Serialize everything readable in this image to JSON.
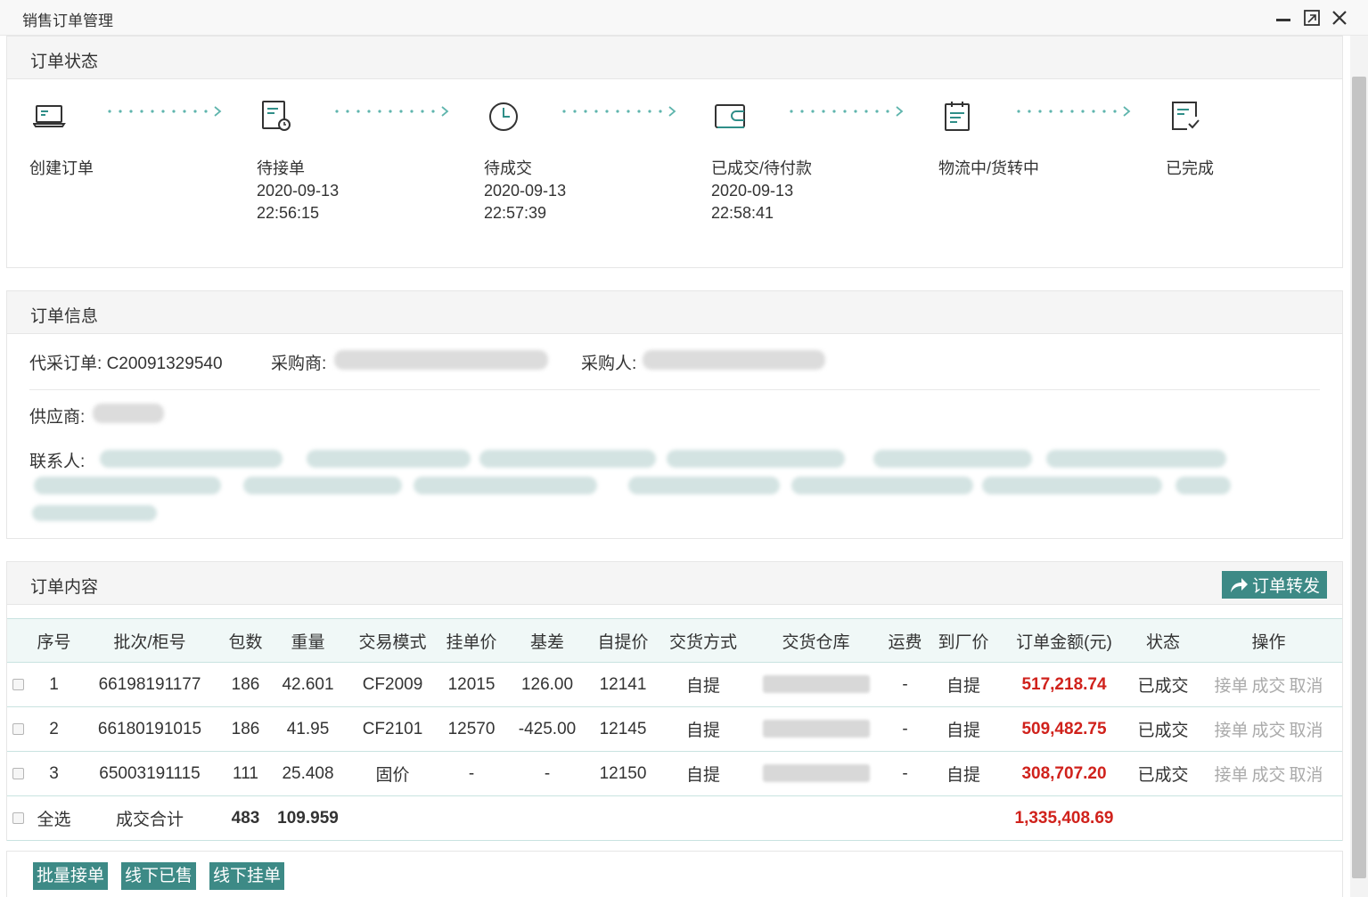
{
  "window": {
    "title": "销售订单管理"
  },
  "status_panel": {
    "title": "订单状态",
    "steps": [
      {
        "label": "创建订单",
        "icon": "laptop-icon",
        "date": "",
        "time": ""
      },
      {
        "label": "待接单",
        "icon": "document-clock-icon",
        "date": "2020-09-13",
        "time": "22:56:15"
      },
      {
        "label": "待成交",
        "icon": "clock-icon",
        "date": "2020-09-13",
        "time": "22:57:39"
      },
      {
        "label": "已成交/待付款",
        "icon": "wallet-icon",
        "date": "2020-09-13",
        "time": "22:58:41"
      },
      {
        "label": "物流中/货转中",
        "icon": "clipboard-icon",
        "date": "",
        "time": ""
      },
      {
        "label": "已完成",
        "icon": "document-check-icon",
        "date": "",
        "time": ""
      }
    ]
  },
  "info_panel": {
    "title": "订单信息",
    "order_label": "代采订单:",
    "order_no": "C20091329540",
    "buyer_label": "采购商:",
    "purchaser_label": "采购人:",
    "supplier_label": "供应商:",
    "contact_label": "联系人:"
  },
  "content_panel": {
    "title": "订单内容",
    "forward_button": "订单转发",
    "columns": [
      "序号",
      "批次/柜号",
      "包数",
      "重量",
      "交易模式",
      "挂单价",
      "基差",
      "自提价",
      "交货方式",
      "交货仓库",
      "运费",
      "到厂价",
      "订单金额(元)",
      "状态",
      "操作"
    ],
    "rows": [
      {
        "seq": "1",
        "batch": "66198191177",
        "packs": "186",
        "weight": "42.601",
        "mode": "CF2009",
        "list_price": "12015",
        "basis": "126.00",
        "pickup_price": "12141",
        "delivery": "自提",
        "freight": "-",
        "factory_price": "自提",
        "amount": "517,218.74",
        "status": "已成交"
      },
      {
        "seq": "2",
        "batch": "66180191015",
        "packs": "186",
        "weight": "41.95",
        "mode": "CF2101",
        "list_price": "12570",
        "basis": "-425.00",
        "pickup_price": "12145",
        "delivery": "自提",
        "freight": "-",
        "factory_price": "自提",
        "amount": "509,482.75",
        "status": "已成交"
      },
      {
        "seq": "3",
        "batch": "65003191115",
        "packs": "111",
        "weight": "25.408",
        "mode": "固价",
        "list_price": "-",
        "basis": "-",
        "pickup_price": "12150",
        "delivery": "自提",
        "freight": "-",
        "factory_price": "自提",
        "amount": "308,707.20",
        "status": "已成交"
      }
    ],
    "ops": {
      "accept": "接单",
      "deal": "成交",
      "cancel": "取消"
    },
    "total": {
      "select_all": "全选",
      "label": "成交合计",
      "packs": "483",
      "weight": "109.959",
      "amount": "1,335,408.69"
    }
  },
  "bottom_bar": {
    "batch_accept": "批量接单",
    "offline_sold": "线下已售",
    "offline_list": "线下挂单"
  },
  "colors": {
    "accent": "#3d8a86",
    "amount_red": "#d0221c",
    "step_icon": "#2f8e88"
  }
}
